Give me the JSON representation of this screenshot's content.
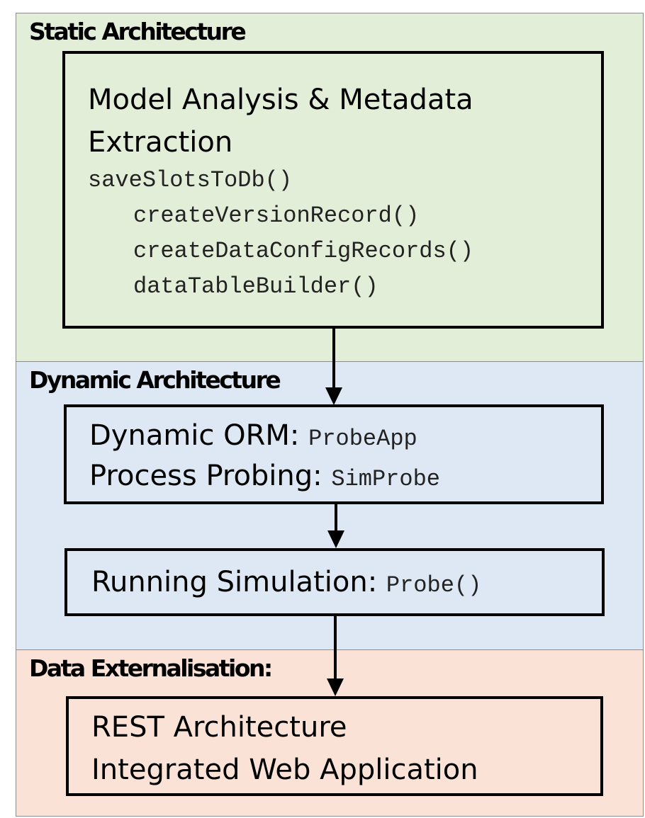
{
  "sections": {
    "static": {
      "title": "Static Architecture",
      "color": "#e3eed9"
    },
    "dynamic": {
      "title": "Dynamic Architecture",
      "color": "#dde8f4"
    },
    "data": {
      "title": "Data Externalisation:",
      "color": "#fae3d6"
    }
  },
  "boxes": {
    "metadata": {
      "title_line1": "Model Analysis & Metadata",
      "title_line2": "Extraction",
      "code": [
        "saveSlotsToDb()",
        "createVersionRecord()",
        "createDataConfigRecords()",
        "dataTableBuilder()"
      ]
    },
    "orm": {
      "line1_label": "Dynamic ORM:",
      "line1_code": "ProbeApp",
      "line2_label": "Process Probing:",
      "line2_code": "SimProbe"
    },
    "simulation": {
      "label": "Running Simulation:",
      "code": "Probe()"
    },
    "rest": {
      "line1": "REST Architecture",
      "line2": "Integrated Web Application"
    }
  },
  "arrows": [
    {
      "from": "Model Analysis & Metadata Extraction",
      "to": "Dynamic ORM"
    },
    {
      "from": "Dynamic ORM",
      "to": "Running Simulation"
    },
    {
      "from": "Running Simulation",
      "to": "REST Architecture"
    }
  ]
}
